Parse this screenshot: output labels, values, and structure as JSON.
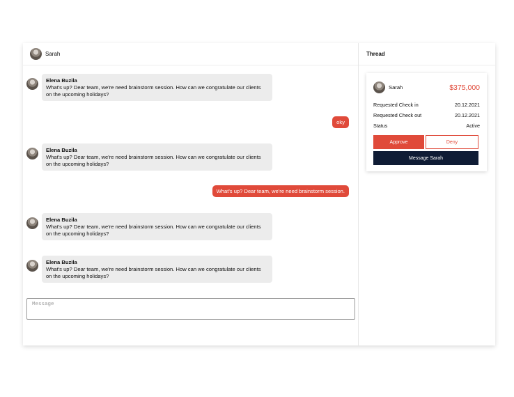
{
  "chat": {
    "header_name": "Sarah",
    "messages": [
      {
        "sender": "Elena Buzila",
        "text": "What's up? Dear team, we're need brainstorm session. How can we congratulate our clients on the upcoming holidays?"
      },
      {
        "text": "oky"
      },
      {
        "sender": "Elena Buzila",
        "text": "What's up? Dear team, we're need brainstorm session. How can we congratulate our clients on the upcoming holidays?"
      },
      {
        "text": "What's up? Dear team, we're need brainstorm session."
      },
      {
        "sender": "Elena Buzila",
        "text": "What's up? Dear team, we're need brainstorm session. How can we congratulate our clients on the upcoming holidays?"
      },
      {
        "sender": "Elena Buzila",
        "text": "What's up? Dear team, we're need brainstorm session. How can we congratulate our clients on the upcoming holidays?"
      }
    ],
    "composer_placeholder": "Message"
  },
  "thread": {
    "title": "Thread",
    "card": {
      "name": "Sarah",
      "price": "$375,000",
      "rows": [
        {
          "label": "Requested Check in",
          "value": "20.12.2021"
        },
        {
          "label": "Requested Check out",
          "value": "20.12.2021"
        },
        {
          "label": "Status",
          "value": "Active"
        }
      ],
      "approve_label": "Approve",
      "deny_label": "Deny",
      "message_label": "Message Sarah"
    }
  },
  "colors": {
    "accent": "#e04a3a",
    "dark_button": "#0f1c35",
    "bubble_incoming": "#ececec"
  }
}
